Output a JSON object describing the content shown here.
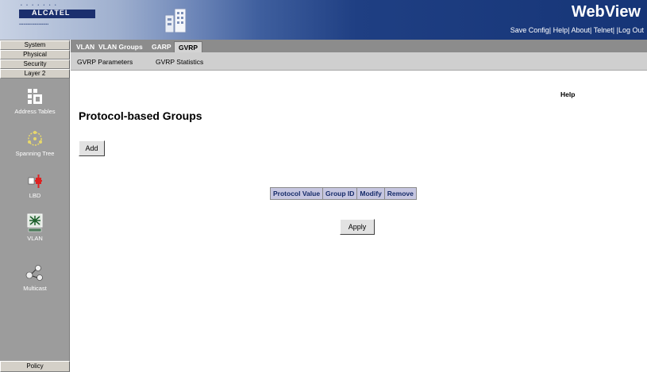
{
  "header": {
    "brand_text": "ALCATEL",
    "app_title": "WebView",
    "links": [
      {
        "label": "Save Config"
      },
      {
        "label": "Help"
      },
      {
        "label": "About"
      },
      {
        "label": "Telnet"
      },
      {
        "label": "Log Out"
      }
    ],
    "link_separator": "|"
  },
  "sidebar": {
    "top_buttons": [
      "System",
      "Physical",
      "Security",
      "Layer 2"
    ],
    "items": [
      {
        "label": "Address Tables",
        "icon": "address-table-icon"
      },
      {
        "label": "Spanning Tree",
        "icon": "spanning-tree-icon"
      },
      {
        "label": "LBD",
        "icon": "lbd-icon"
      },
      {
        "label": "VLAN",
        "icon": "vlan-icon"
      },
      {
        "label": "Multicast",
        "icon": "multicast-icon"
      }
    ],
    "bottom_button": "Policy"
  },
  "tabs": [
    {
      "label": "VLAN",
      "active": false
    },
    {
      "label": "VLAN Groups",
      "active": false
    },
    {
      "label": "GARP",
      "active": false
    },
    {
      "label": "GVRP",
      "active": true
    }
  ],
  "subtabs": [
    "GVRP Parameters",
    "GVRP Statistics"
  ],
  "main": {
    "help_label": "Help",
    "title": "Protocol-based Groups",
    "add_label": "Add",
    "apply_label": "Apply",
    "table": {
      "columns": [
        "Protocol Value",
        "Group ID",
        "Modify",
        "Remove"
      ],
      "rows": []
    }
  },
  "colors": {
    "header_dark": "#163577",
    "sidebar_bg": "#9c9c9c",
    "table_header_bg": "#c6c6e0"
  }
}
